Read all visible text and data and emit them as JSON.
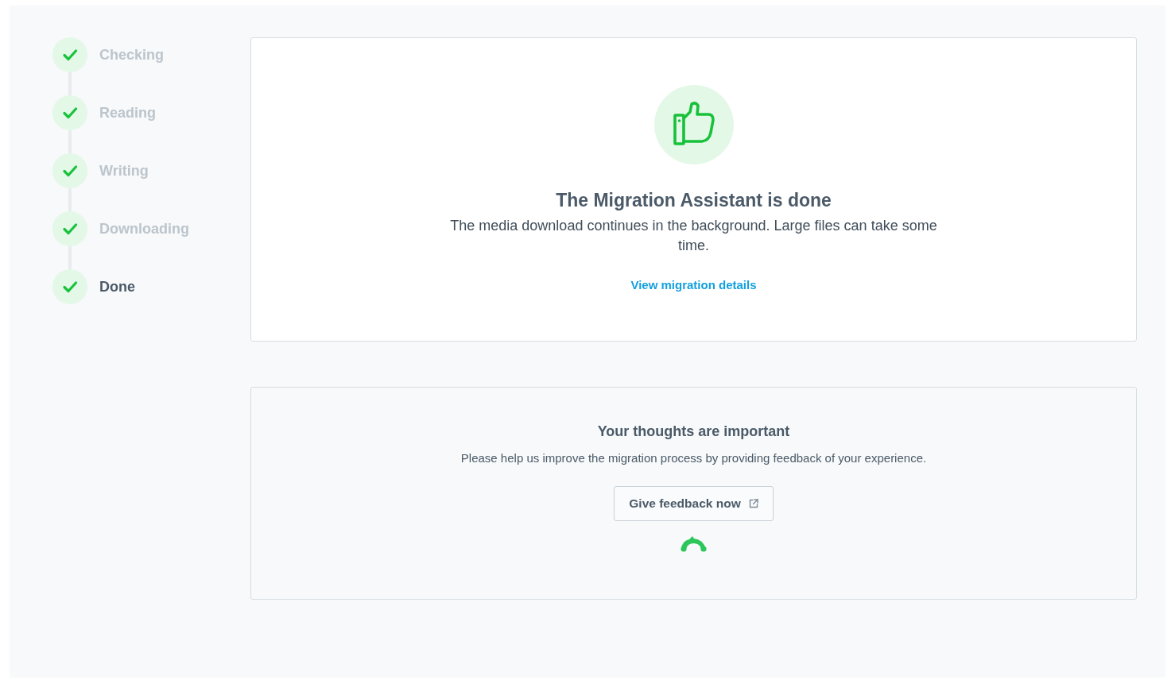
{
  "steps": [
    {
      "label": "Checking",
      "done": true,
      "current": false
    },
    {
      "label": "Reading",
      "done": true,
      "current": false
    },
    {
      "label": "Writing",
      "done": true,
      "current": false
    },
    {
      "label": "Downloading",
      "done": true,
      "current": false
    },
    {
      "label": "Done",
      "done": true,
      "current": true
    }
  ],
  "result_card": {
    "title": "The Migration Assistant is done",
    "message": "The media download continues in the background. Large files can take some time.",
    "link": "View migration details"
  },
  "feedback_card": {
    "title": "Your thoughts are important",
    "message": "Please help us improve the migration process by providing feedback of your experience.",
    "button": "Give feedback now"
  }
}
